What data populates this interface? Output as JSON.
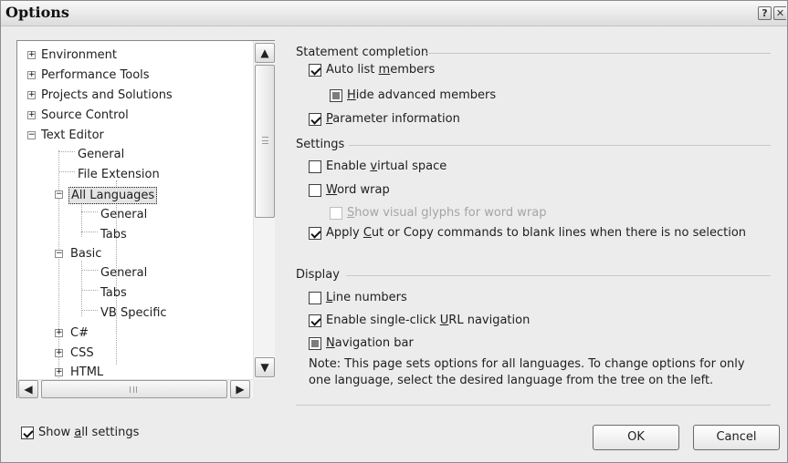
{
  "window": {
    "title": "Options",
    "help_glyph": "?",
    "close_glyph": "✕"
  },
  "tree": {
    "items": [
      {
        "label": "Environment",
        "expander": "+"
      },
      {
        "label": "Performance Tools",
        "expander": "+"
      },
      {
        "label": "Projects and Solutions",
        "expander": "+"
      },
      {
        "label": "Source Control",
        "expander": "+"
      },
      {
        "label": "Text Editor",
        "expander": "−"
      },
      {
        "label": "General"
      },
      {
        "label": "File Extension"
      },
      {
        "label": "All Languages",
        "expander": "−",
        "selected": true
      },
      {
        "label": "General"
      },
      {
        "label": "Tabs"
      },
      {
        "label": "Basic",
        "expander": "−"
      },
      {
        "label": "General"
      },
      {
        "label": "Tabs"
      },
      {
        "label": "VB Specific"
      },
      {
        "label": "C#",
        "expander": "+"
      },
      {
        "label": "CSS",
        "expander": "+"
      },
      {
        "label": "HTML",
        "expander": "+"
      }
    ],
    "scroll_up_glyph": "▲",
    "scroll_down_glyph": "▼",
    "scroll_left_glyph": "◀",
    "scroll_right_glyph": "▶"
  },
  "statement_completion": {
    "header": "Statement completion",
    "auto_list_members": {
      "pre": "Auto list ",
      "ul": "m",
      "post": "embers",
      "checked": true
    },
    "hide_advanced_members": {
      "pre": "",
      "ul": "H",
      "post": "ide advanced members",
      "state": "indeterminate"
    },
    "parameter_information": {
      "pre": "",
      "ul": "P",
      "post": "arameter information",
      "checked": true
    }
  },
  "settings": {
    "header": "Settings",
    "enable_virtual_space": {
      "pre": "Enable ",
      "ul": "v",
      "post": "irtual space",
      "checked": false
    },
    "word_wrap": {
      "pre": "",
      "ul": "W",
      "post": "ord wrap",
      "checked": false
    },
    "show_visual_glyphs": {
      "pre": "",
      "ul": "S",
      "post": "how visual glyphs for word wrap",
      "checked": false,
      "disabled": true
    },
    "apply_cut_copy": {
      "pre": "Apply ",
      "ul": "C",
      "post": "ut or Copy commands to blank lines when there is no selection",
      "checked": true
    }
  },
  "display": {
    "header": "Display",
    "line_numbers": {
      "pre": "",
      "ul": "L",
      "post": "ine numbers",
      "checked": false
    },
    "single_click_url": {
      "pre": "Enable single-click ",
      "ul": "U",
      "post": "RL navigation",
      "checked": true
    },
    "navigation_bar": {
      "pre": "",
      "ul": "N",
      "post": "avigation bar",
      "state": "indeterminate"
    },
    "note": "Note: This page sets options for all languages. To change options for only one language, select the desired language from the tree on the left."
  },
  "footer": {
    "show_all_settings": {
      "pre": "Show ",
      "ul": "a",
      "post": "ll settings",
      "checked": true
    },
    "ok_label": "OK",
    "cancel_label": "Cancel"
  },
  "colors": {
    "window_bg": "#ececec",
    "selection_bg": "#e4e4e4",
    "disabled_text": "#a5a5a5"
  }
}
